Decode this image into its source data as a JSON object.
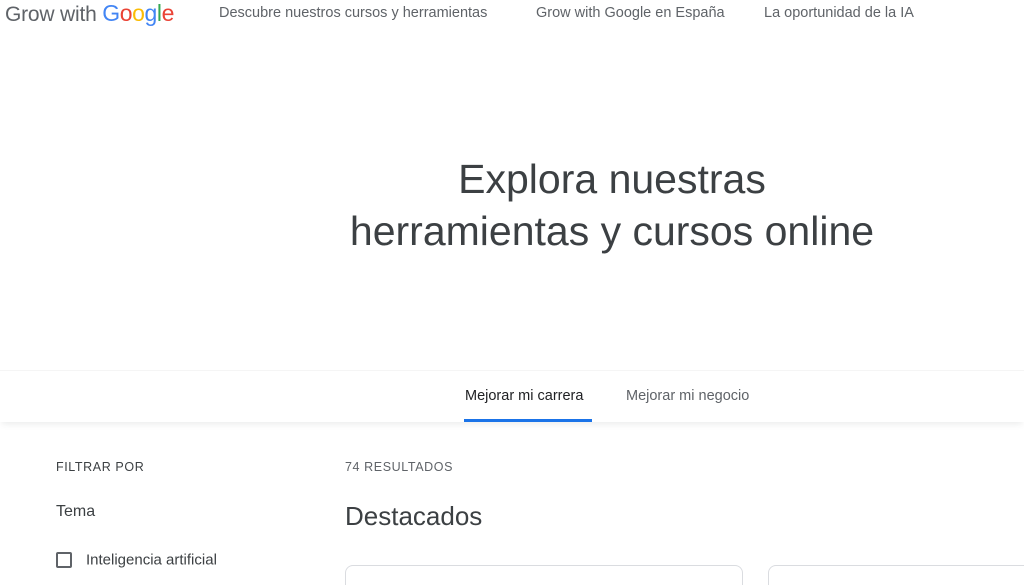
{
  "header": {
    "logo_prefix": "Grow with ",
    "logo_brand": [
      {
        "ch": "G",
        "color": "#4285F4"
      },
      {
        "ch": "o",
        "color": "#EA4335"
      },
      {
        "ch": "o",
        "color": "#FBBC05"
      },
      {
        "ch": "g",
        "color": "#4285F4"
      },
      {
        "ch": "l",
        "color": "#34A853"
      },
      {
        "ch": "e",
        "color": "#EA4335"
      }
    ],
    "nav": [
      "Descubre nuestros cursos y herramientas",
      "Grow with Google en España",
      "La oportunidad de la IA"
    ]
  },
  "hero": {
    "title_line1": "Explora nuestras",
    "title_line2": "herramientas y cursos online"
  },
  "tabs": {
    "items": [
      "Mejorar mi carrera",
      "Mejorar mi negocio"
    ],
    "active_index": 0,
    "accent_color": "#1a73e8"
  },
  "filters": {
    "heading": "FILTRAR POR",
    "topic_label": "Tema",
    "options": [
      "Inteligencia artificial"
    ]
  },
  "results": {
    "count_label": "74 RESULTADOS",
    "section_title": "Destacados"
  }
}
